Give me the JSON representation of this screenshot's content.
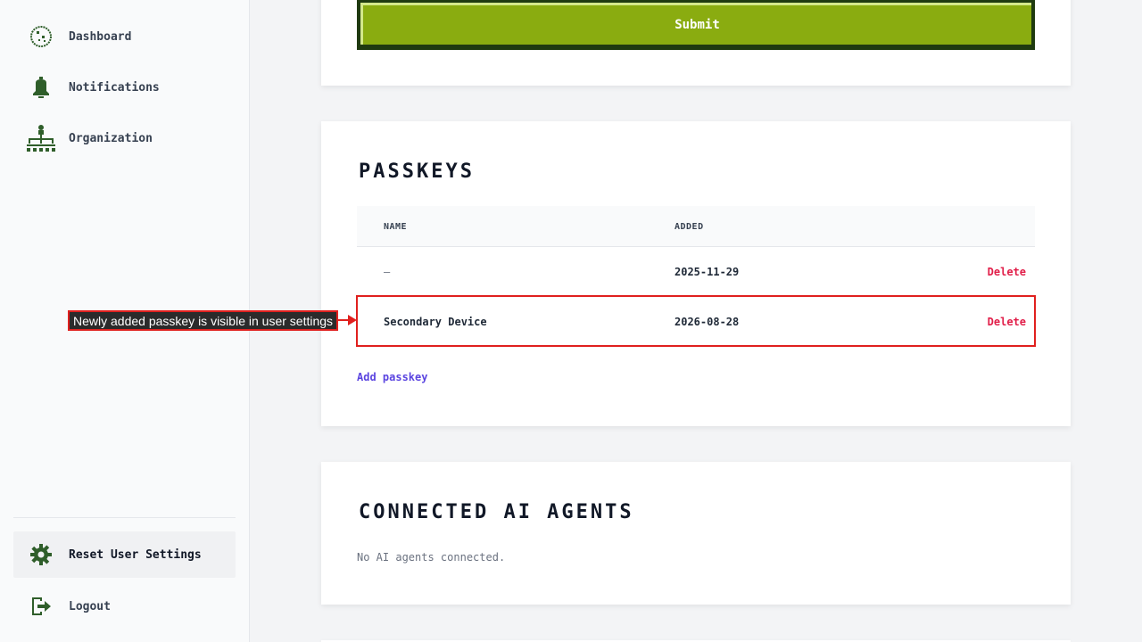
{
  "sidebar": {
    "items": [
      {
        "label": "Dashboard",
        "icon": "dashboard-icon"
      },
      {
        "label": "Notifications",
        "icon": "bell-icon"
      },
      {
        "label": "Organization",
        "icon": "org-chart-icon"
      }
    ],
    "bottom_items": [
      {
        "label": "Reset User Settings",
        "icon": "gear-icon"
      },
      {
        "label": "Logout",
        "icon": "logout-icon"
      }
    ]
  },
  "form": {
    "submit_label": "Submit"
  },
  "passkeys": {
    "title": "Passkeys",
    "columns": {
      "name": "NAME",
      "added": "ADDED"
    },
    "rows": [
      {
        "name": "–",
        "added": "2025-11-29",
        "action": "Delete"
      },
      {
        "name": "Secondary Device",
        "added": "2026-08-28",
        "action": "Delete"
      }
    ],
    "add_label": "Add passkey"
  },
  "agents": {
    "title": "Connected AI Agents",
    "empty_text": "No AI agents connected."
  },
  "annotation": {
    "text": "Newly added passkey is visible in user settings"
  },
  "colors": {
    "accent_green": "#8aac10",
    "icon_green": "#2f5e2a",
    "delete_red": "#e11d48",
    "link_purple": "#5b45e0",
    "annotation_red": "#e0201e"
  }
}
